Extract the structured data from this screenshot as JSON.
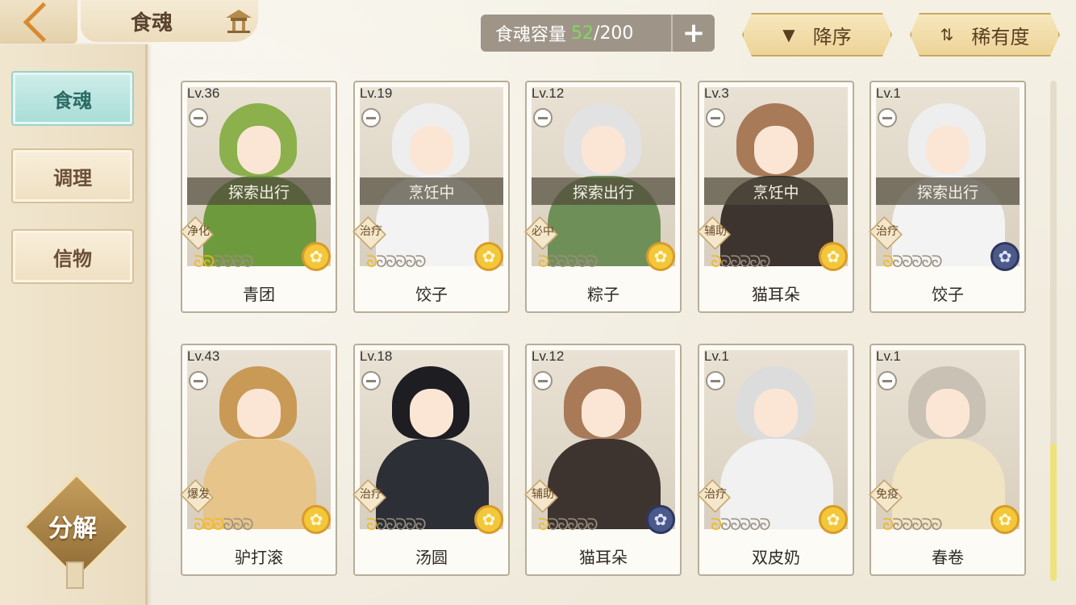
{
  "header": {
    "title": "食魂",
    "capacity_label": "食魂容量",
    "capacity_current": "52",
    "capacity_sep": "/",
    "capacity_max": "200",
    "plus_label": "+",
    "sort_order_label": "降序",
    "sort_order_icon": "▼",
    "sort_rarity_label": "稀有度",
    "sort_rarity_icon": "⇅"
  },
  "sidebar": {
    "items": [
      {
        "label": "食魂",
        "active": true
      },
      {
        "label": "调理",
        "active": false
      },
      {
        "label": "信物",
        "active": false
      }
    ],
    "decompose_label": "分解"
  },
  "cards": [
    {
      "level": "Lv.36",
      "status": "探索出行",
      "role": "净化",
      "flames": 2,
      "rarity": "gold",
      "name": "青团",
      "hair": "#8bb04c",
      "body": "#6e9a3e"
    },
    {
      "level": "Lv.19",
      "status": "烹饪中",
      "role": "治疗",
      "flames": 1,
      "rarity": "gold",
      "name": "饺子",
      "hair": "#eeeeee",
      "body": "#f3f3f3"
    },
    {
      "level": "Lv.12",
      "status": "探索出行",
      "role": "必中",
      "flames": 1,
      "rarity": "gold",
      "name": "粽子",
      "hair": "#e2e2e2",
      "body": "#6f8f58"
    },
    {
      "level": "Lv.3",
      "status": "烹饪中",
      "role": "辅助",
      "flames": 1,
      "rarity": "gold",
      "name": "猫耳朵",
      "hair": "#a87a58",
      "body": "#3d3430"
    },
    {
      "level": "Lv.1",
      "status": "探索出行",
      "role": "治疗",
      "flames": 1,
      "rarity": "blue",
      "name": "饺子",
      "hair": "#eeeeee",
      "body": "#f3f3f3"
    },
    {
      "level": "Lv.43",
      "status": "",
      "role": "爆发",
      "flames": 3,
      "rarity": "gold",
      "name": "驴打滚",
      "hair": "#c99a55",
      "body": "#e7c58a"
    },
    {
      "level": "Lv.18",
      "status": "",
      "role": "治疗",
      "flames": 1,
      "rarity": "gold",
      "name": "汤圆",
      "hair": "#1d1d22",
      "body": "#2d2f36"
    },
    {
      "level": "Lv.12",
      "status": "",
      "role": "辅助",
      "flames": 1,
      "rarity": "blue",
      "name": "猫耳朵",
      "hair": "#a87a58",
      "body": "#3d3430"
    },
    {
      "level": "Lv.1",
      "status": "",
      "role": "治疗",
      "flames": 1,
      "rarity": "gold",
      "name": "双皮奶",
      "hair": "#dcdcdc",
      "body": "#f1f1f1"
    },
    {
      "level": "Lv.1",
      "status": "",
      "role": "免疫",
      "flames": 1,
      "rarity": "gold",
      "name": "春卷",
      "hair": "#c9c1b4",
      "body": "#f1e4c2"
    }
  ],
  "icons": {
    "flame": "ꞩ",
    "rarity_flower": "✿",
    "back": "back-arrow-icon",
    "house": "pavilion-icon",
    "bowl": "bowl-icon"
  },
  "colors": {
    "accent_gold": "#f2b71d",
    "active_tab": "#a8dcd6",
    "capacity_value": "#7ddb5a"
  }
}
